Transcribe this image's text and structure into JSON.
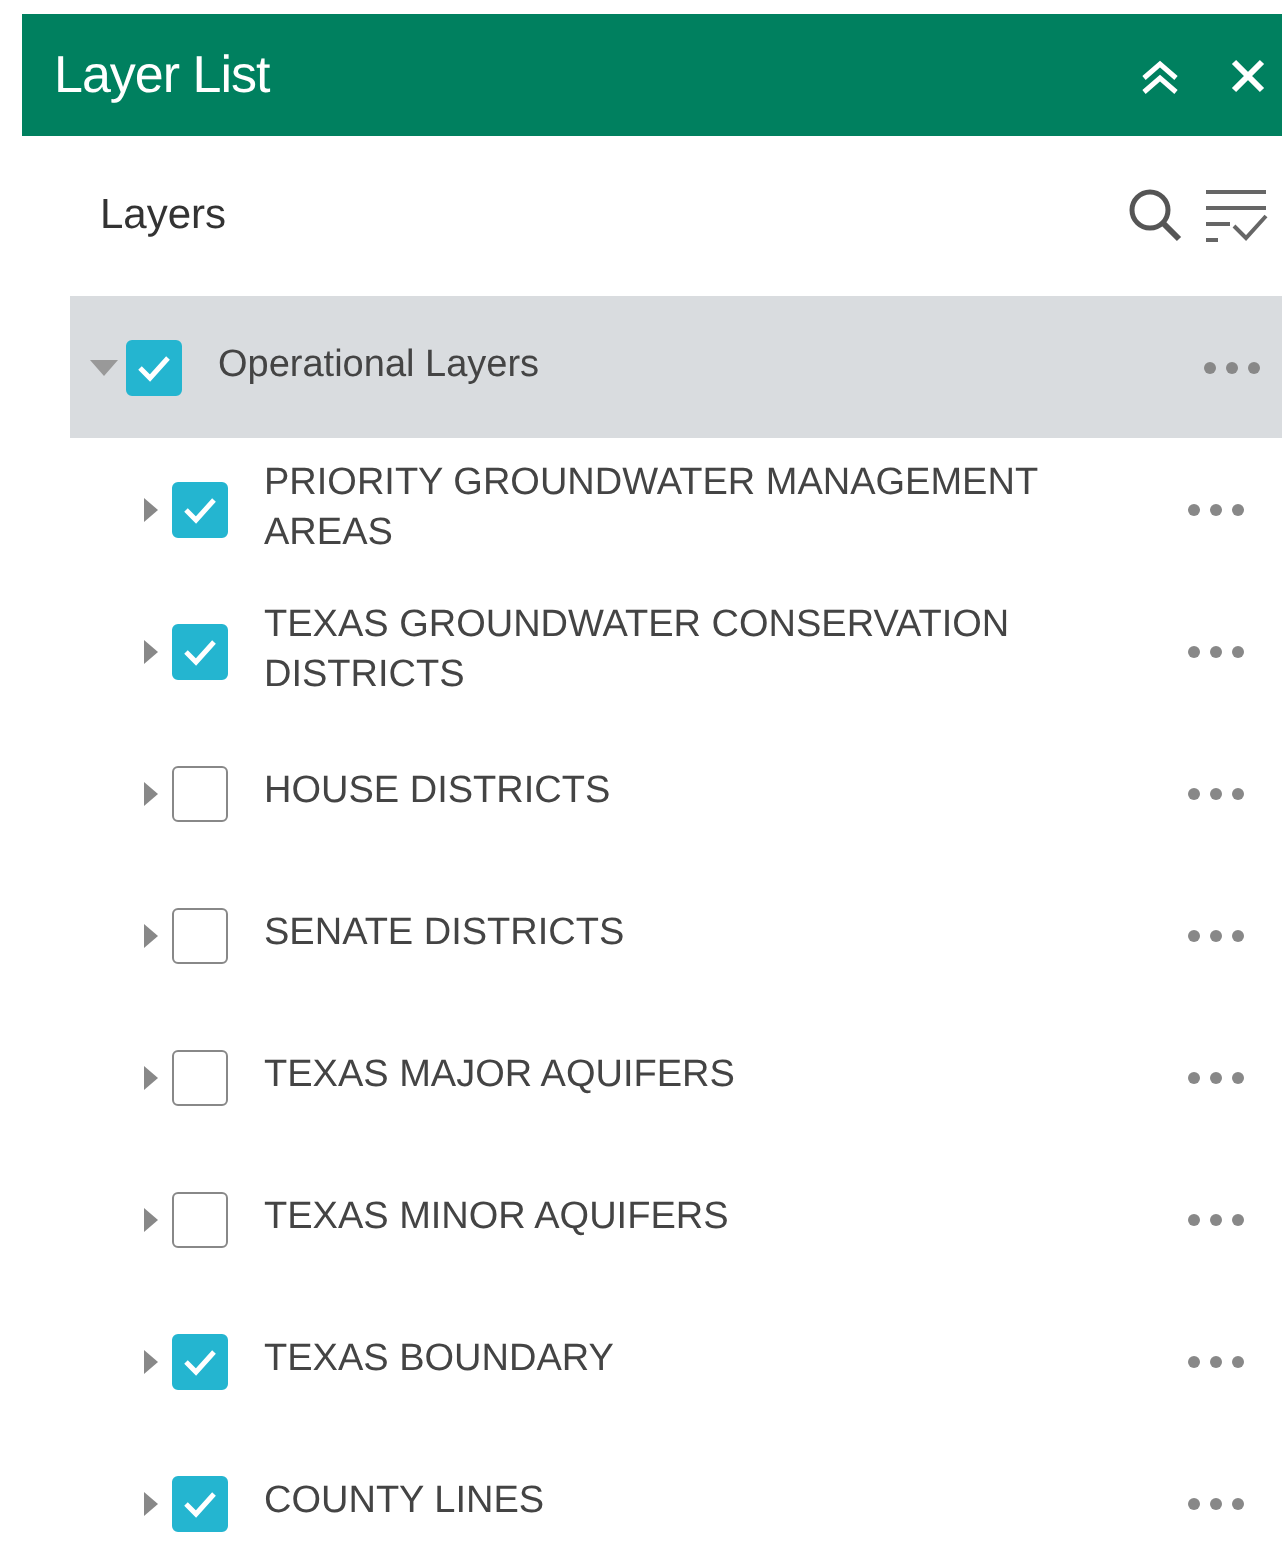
{
  "panel": {
    "title": "Layer List"
  },
  "layers_header": {
    "label": "Layers"
  },
  "tree": [
    {
      "label": "Operational Layers",
      "checked": true,
      "expanded": true,
      "selected": true,
      "children": [
        {
          "label": "PRIORITY GROUNDWATER MANAGEMENT AREAS",
          "checked": true,
          "expanded": false,
          "selected": false
        },
        {
          "label": "TEXAS GROUNDWATER CONSERVATION DISTRICTS",
          "checked": true,
          "expanded": false,
          "selected": false
        },
        {
          "label": "HOUSE DISTRICTS",
          "checked": false,
          "expanded": false,
          "selected": false
        },
        {
          "label": "SENATE DISTRICTS",
          "checked": false,
          "expanded": false,
          "selected": false
        },
        {
          "label": "TEXAS MAJOR AQUIFERS",
          "checked": false,
          "expanded": false,
          "selected": false
        },
        {
          "label": "TEXAS MINOR AQUIFERS",
          "checked": false,
          "expanded": false,
          "selected": false
        },
        {
          "label": "TEXAS BOUNDARY",
          "checked": true,
          "expanded": false,
          "selected": false
        },
        {
          "label": "COUNTY LINES",
          "checked": true,
          "expanded": false,
          "selected": false
        }
      ]
    }
  ]
}
